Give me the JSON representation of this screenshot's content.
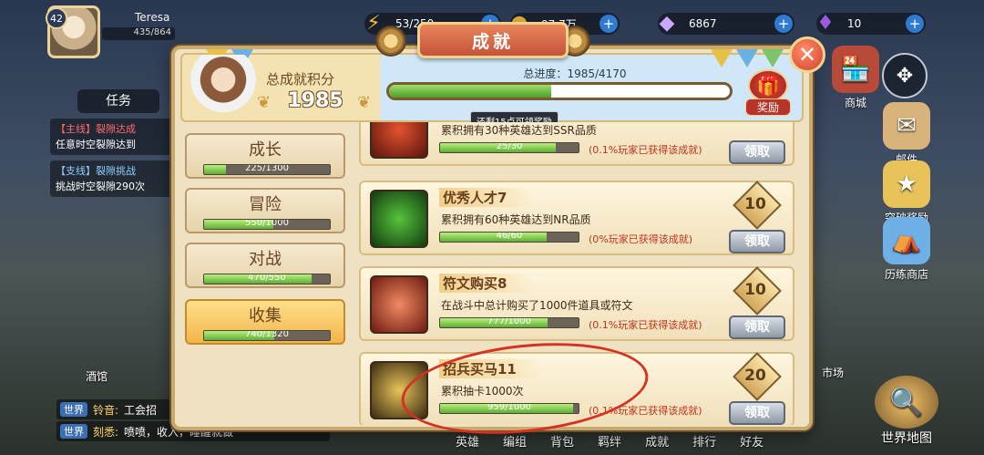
{
  "player": {
    "name": "Teresa",
    "level": "42",
    "exp": "435/864"
  },
  "resources": [
    {
      "icon": "energy-icon",
      "value": "53/250",
      "color": "#f2c13a"
    },
    {
      "icon": "gold-coin-icon",
      "value": "97.7万",
      "color": "#d9a736"
    },
    {
      "icon": "diamond-icon",
      "value": "6867",
      "color": "#c9a7ff"
    },
    {
      "icon": "crystal-icon",
      "value": "10",
      "color": "#9b5be0"
    }
  ],
  "quest": {
    "title": "任务",
    "main_tag": "【主线】",
    "main_name": "裂隙达成",
    "main_desc": "任意时空裂隙达到",
    "side_tag": "【支线】",
    "side_name": "裂隙挑战",
    "side_desc": "挑战时空裂隙290次"
  },
  "tavern": "酒馆",
  "chat": [
    {
      "channel": "世界",
      "who": "铃音:",
      "text": "工会招"
    },
    {
      "channel": "世界",
      "who": "刻悉:",
      "text": "喷喷，收入，睡醒就做"
    }
  ],
  "right_menu": {
    "shop": "商城",
    "mail": "邮件",
    "breakthrough": "突破奖励",
    "trial_shop": "历练商店",
    "market": "市场",
    "world_map": "世界地图"
  },
  "bottom_nav": [
    "英雄",
    "编组",
    "背包",
    "羁绊",
    "成就",
    "排行",
    "好友"
  ],
  "achievement": {
    "title": "成就",
    "score_label": "总成就积分",
    "score": "1985",
    "total_label": "总进度：",
    "total_value": "1985/4170",
    "total_progress": 0.476,
    "hint": "还剩15点可领奖励",
    "reward_label": "奖励"
  },
  "categories": [
    {
      "name": "成长",
      "progress": "225/1300",
      "ratio": 0.173,
      "selected": false
    },
    {
      "name": "冒险",
      "progress": "550/1000",
      "ratio": 0.55,
      "selected": false
    },
    {
      "name": "对战",
      "progress": "470/550",
      "ratio": 0.855,
      "selected": false
    },
    {
      "name": "收集",
      "progress": "740/1320",
      "ratio": 0.561,
      "selected": true
    }
  ],
  "items": [
    {
      "title": "",
      "desc": "累积拥有30种英雄达到SSR品质",
      "progress": "25/30",
      "ratio": 0.833,
      "pct": "(0.1%玩家已获得该成就)",
      "points": "",
      "claim": "领取",
      "icon_color": "#c8321e"
    },
    {
      "title": "优秀人才7",
      "desc": "累积拥有60种英雄达到NR品质",
      "progress": "46/60",
      "ratio": 0.767,
      "pct": "(0%玩家已获得该成就)",
      "points": "10",
      "claim": "领取",
      "icon_color": "#2f8a2a"
    },
    {
      "title": "符文购买8",
      "desc": "在战斗中总计购买了1000件道具或符文",
      "progress": "777/1000",
      "ratio": 0.777,
      "pct": "(0.1%玩家已获得该成就)",
      "points": "10",
      "claim": "领取",
      "icon_color": "#c8321e"
    },
    {
      "title": "招兵买马11",
      "desc": "累积抽卡1000次",
      "progress": "959/1000",
      "ratio": 0.959,
      "pct": "(0.1%玩家已获得该成就)",
      "points": "20",
      "claim": "领取",
      "icon_color": "#c89a2a"
    }
  ]
}
